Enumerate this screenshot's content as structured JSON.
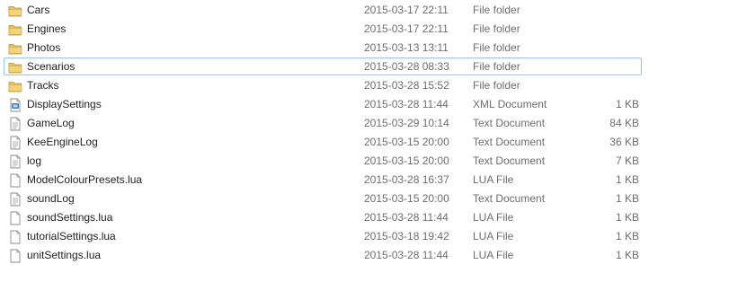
{
  "files": [
    {
      "name": "Cars",
      "date": "2015-03-17 22:11",
      "type": "File folder",
      "size": "",
      "icon": "folder-icon"
    },
    {
      "name": "Engines",
      "date": "2015-03-17 22:11",
      "type": "File folder",
      "size": "",
      "icon": "folder-icon"
    },
    {
      "name": "Photos",
      "date": "2015-03-13 13:11",
      "type": "File folder",
      "size": "",
      "icon": "folder-icon"
    },
    {
      "name": "Scenarios",
      "date": "2015-03-28 08:33",
      "type": "File folder",
      "size": "",
      "icon": "folder-icon",
      "highlighted": true
    },
    {
      "name": "Tracks",
      "date": "2015-03-28 15:52",
      "type": "File folder",
      "size": "",
      "icon": "folder-icon"
    },
    {
      "name": "DisplaySettings",
      "date": "2015-03-28 11:44",
      "type": "XML Document",
      "size": "1 KB",
      "icon": "xml-document-icon"
    },
    {
      "name": "GameLog",
      "date": "2015-03-29 10:14",
      "type": "Text Document",
      "size": "84 KB",
      "icon": "text-document-icon"
    },
    {
      "name": "KeeEngineLog",
      "date": "2015-03-15 20:00",
      "type": "Text Document",
      "size": "36 KB",
      "icon": "text-document-icon"
    },
    {
      "name": "log",
      "date": "2015-03-15 20:00",
      "type": "Text Document",
      "size": "7 KB",
      "icon": "text-document-icon"
    },
    {
      "name": "ModelColourPresets.lua",
      "date": "2015-03-28 16:37",
      "type": "LUA File",
      "size": "1 KB",
      "icon": "file-icon"
    },
    {
      "name": "soundLog",
      "date": "2015-03-15 20:00",
      "type": "Text Document",
      "size": "1 KB",
      "icon": "text-document-icon"
    },
    {
      "name": "soundSettings.lua",
      "date": "2015-03-28 11:44",
      "type": "LUA File",
      "size": "1 KB",
      "icon": "file-icon"
    },
    {
      "name": "tutorialSettings.lua",
      "date": "2015-03-18 19:42",
      "type": "LUA File",
      "size": "1 KB",
      "icon": "file-icon"
    },
    {
      "name": "unitSettings.lua",
      "date": "2015-03-28 11:44",
      "type": "LUA File",
      "size": "1 KB",
      "icon": "file-icon"
    }
  ],
  "colors": {
    "folder": "#e8c25a",
    "highlight_border": "#9fc6ea",
    "secondary_text": "#6d6d6d"
  }
}
